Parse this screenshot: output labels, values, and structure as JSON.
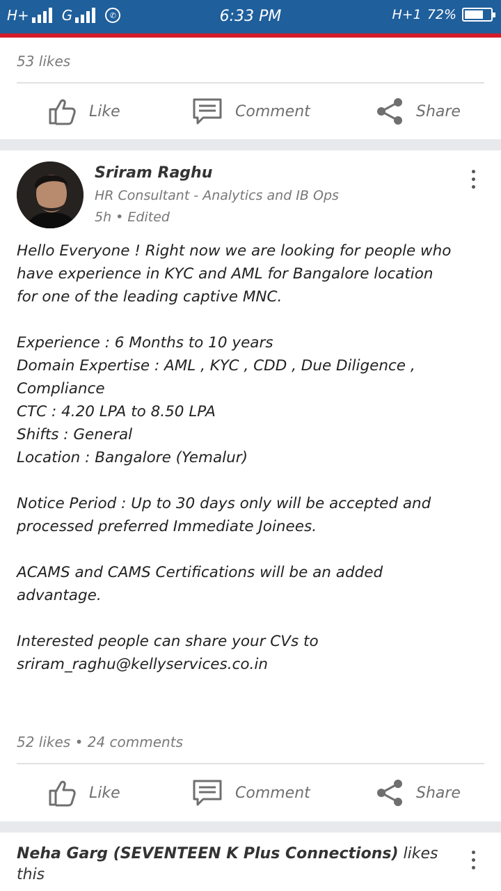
{
  "status_bar": {
    "network1": "H+",
    "network2": "G",
    "time": "6:33 PM",
    "network3": "H+1",
    "battery_percent": "72%",
    "battery_level": 0.72,
    "icons": [
      "signal-icon",
      "whatsapp-icon",
      "battery-icon"
    ]
  },
  "prev_post": {
    "likes_text": "53 likes",
    "actions": {
      "like": "Like",
      "comment": "Comment",
      "share": "Share"
    }
  },
  "post": {
    "author": "Sriram Raghu",
    "headline": "HR Consultant - Analytics and IB Ops",
    "time": "5h • Edited",
    "body_lines": [
      "Hello Everyone ! Right now we are looking for people who",
      "have experience in KYC and AML for Bangalore location",
      "for one of the leading captive MNC.",
      "",
      "Experience : 6 Months to 10 years",
      "Domain Expertise : AML , KYC , CDD , Due Diligence ,",
      "Compliance",
      "CTC : 4.20 LPA to 8.50 LPA",
      "Shifts : General",
      "Location : Bangalore (Yemalur)",
      "",
      "Notice Period : Up to 30 days only will be accepted and",
      "processed preferred Immediate Joinees.",
      "",
      "ACAMS and CAMS Certifications will be an added",
      "advantage.",
      "",
      "Interested people can share your CVs to",
      "sriram_raghu@kellyservices.co.in"
    ],
    "stats": "52 likes • 24 comments",
    "actions": {
      "like": "Like",
      "comment": "Comment",
      "share": "Share"
    }
  },
  "next_post": {
    "activity_actor": "Neha Garg (SEVENTEEN K Plus Connections)",
    "activity_verb": "likes",
    "activity_object": "this"
  },
  "colors": {
    "status_bar": "#1f5f9c",
    "accent_red": "#d21c2b",
    "separator": "#e7e9ec"
  }
}
